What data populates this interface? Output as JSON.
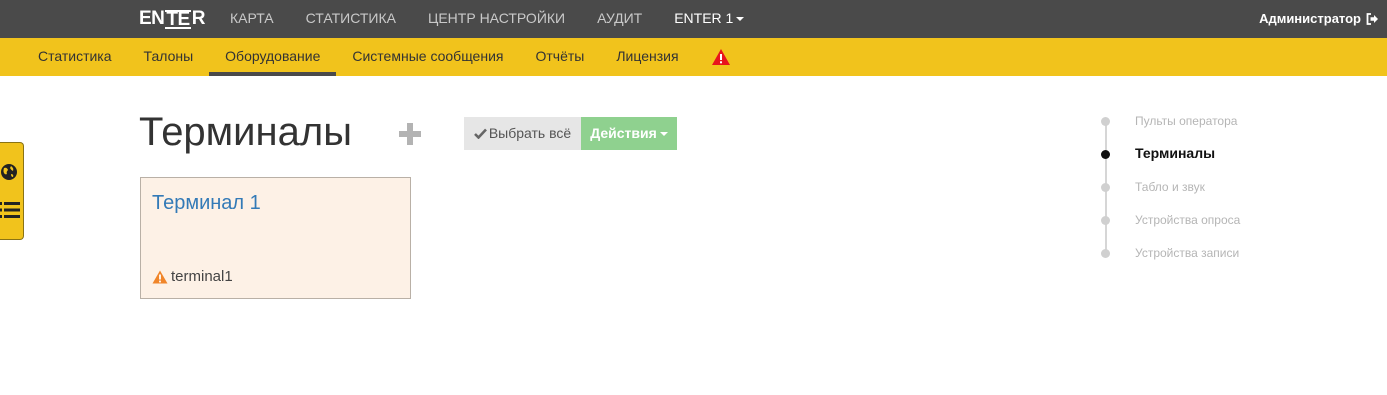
{
  "header": {
    "logo_left": "EN",
    "logo_mid": "TE",
    "logo_right": "R",
    "nav": [
      {
        "label": "КАРТА"
      },
      {
        "label": "СТАТИСТИКА"
      },
      {
        "label": "ЦЕНТР НАСТРОЙКИ"
      },
      {
        "label": "АУДИТ"
      },
      {
        "label": "ENTER 1"
      }
    ],
    "user": "Администратор"
  },
  "subnav": {
    "items": [
      {
        "label": "Статистика"
      },
      {
        "label": "Талоны"
      },
      {
        "label": "Оборудование"
      },
      {
        "label": "Системные сообщения"
      },
      {
        "label": "Отчёты"
      },
      {
        "label": "Лицензия"
      }
    ],
    "active": "Оборудование",
    "alert_color": "#e8141c"
  },
  "main": {
    "title": "Терминалы",
    "select_all": "Выбрать всё",
    "actions": "Действия",
    "card": {
      "title": "Терминал 1",
      "subtitle": "terminal1",
      "warning_color": "#f0852a"
    }
  },
  "timeline": {
    "items": [
      {
        "label": "Пульты оператора"
      },
      {
        "label": "Терминалы"
      },
      {
        "label": "Табло и звук"
      },
      {
        "label": "Устройства опроса"
      },
      {
        "label": "Устройства записи"
      }
    ],
    "active": "Терминалы"
  },
  "colors": {
    "topbar": "#4a4a4a",
    "accent": "#f1c31c",
    "success": "#8fd18f",
    "link": "#337ab7"
  }
}
